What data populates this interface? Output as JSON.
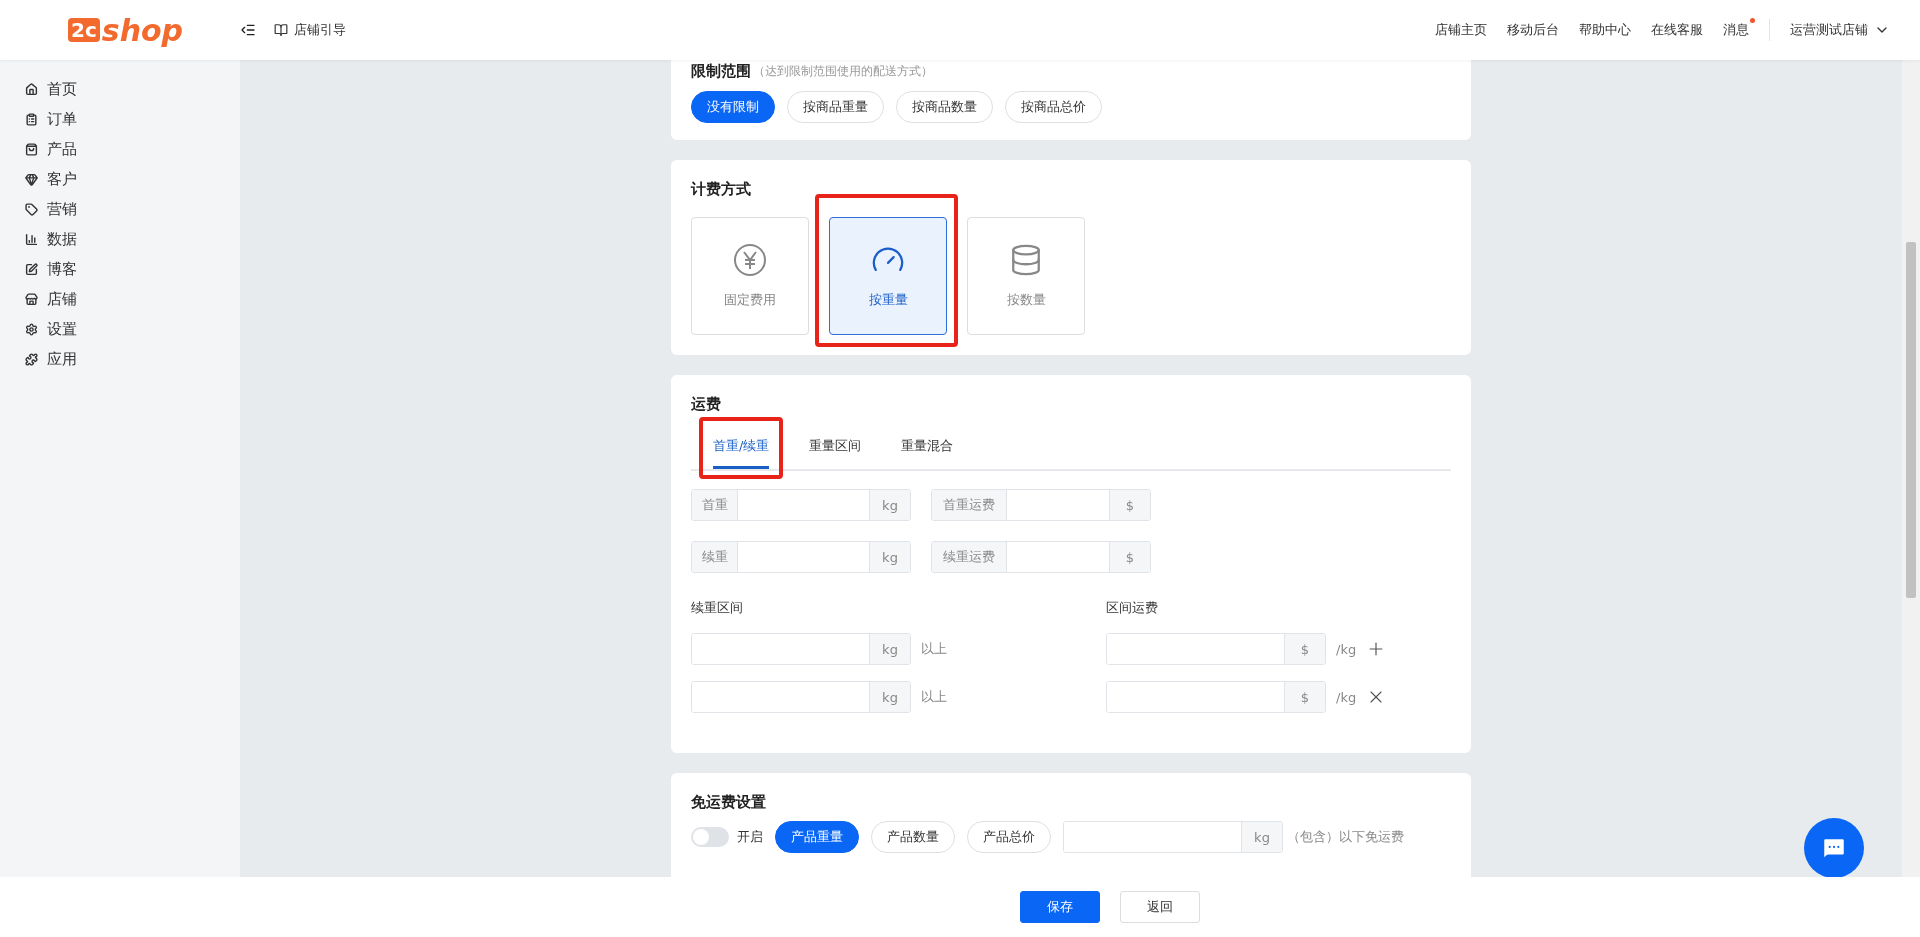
{
  "header": {
    "logo": {
      "mark": "2c",
      "word": "shop"
    },
    "guide": "店铺引导",
    "links": [
      "店铺主页",
      "移动后台",
      "帮助中心",
      "在线客服"
    ],
    "messages": {
      "label": "消息",
      "unread": true
    },
    "store": "运营测试店铺"
  },
  "sidebar": {
    "items": [
      {
        "label": "首页"
      },
      {
        "label": "订单"
      },
      {
        "label": "产品"
      },
      {
        "label": "客户"
      },
      {
        "label": "营销"
      },
      {
        "label": "数据"
      },
      {
        "label": "博客"
      },
      {
        "label": "店铺"
      },
      {
        "label": "设置"
      },
      {
        "label": "应用"
      }
    ]
  },
  "restriction": {
    "title": "限制范围",
    "hint": "（达到限制范围使用的配送方式）",
    "options": [
      {
        "label": "没有限制",
        "selected": true
      },
      {
        "label": "按商品重量",
        "selected": false
      },
      {
        "label": "按商品数量",
        "selected": false
      },
      {
        "label": "按商品总价",
        "selected": false
      }
    ]
  },
  "billing": {
    "title": "计费方式",
    "options": [
      {
        "label": "固定费用",
        "selected": false,
        "highlighted": false
      },
      {
        "label": "按重量",
        "selected": true,
        "highlighted": true
      },
      {
        "label": "按数量",
        "selected": false,
        "highlighted": false
      }
    ]
  },
  "freight": {
    "title": "运费",
    "tabs": [
      {
        "label": "首重/续重",
        "selected": true,
        "highlighted": true
      },
      {
        "label": "重量区间",
        "selected": false,
        "highlighted": false
      },
      {
        "label": "重量混合",
        "selected": false,
        "highlighted": false
      }
    ],
    "fields": [
      {
        "prefix": "首重",
        "suffix": "kg"
      },
      {
        "prefix": "首重运费",
        "suffix": "$"
      },
      {
        "prefix": "续重",
        "suffix": "kg"
      },
      {
        "prefix": "续重运费",
        "suffix": "$"
      }
    ],
    "range": {
      "left_label": "续重区间",
      "right_label": "区间运费",
      "rows": [
        {
          "left_suffix": "kg",
          "left_note": "以上",
          "right_suffix": "$",
          "right_note": "/kg",
          "kind": "add"
        },
        {
          "left_suffix": "kg",
          "left_note": "以上",
          "right_suffix": "$",
          "right_note": "/kg",
          "kind": "remove"
        }
      ]
    }
  },
  "free_shipping": {
    "title": "免运费设置",
    "toggle": {
      "on": false,
      "label": "开启"
    },
    "options": [
      {
        "label": "产品重量",
        "selected": true
      },
      {
        "label": "产品数量",
        "selected": false
      },
      {
        "label": "产品总价",
        "selected": false
      }
    ],
    "field": {
      "suffix": "kg"
    },
    "note": "（包含）以下免运费"
  },
  "footer": {
    "buttons": [
      {
        "label": "保存",
        "kind": "primary"
      },
      {
        "label": "返回",
        "kind": "default"
      }
    ]
  }
}
